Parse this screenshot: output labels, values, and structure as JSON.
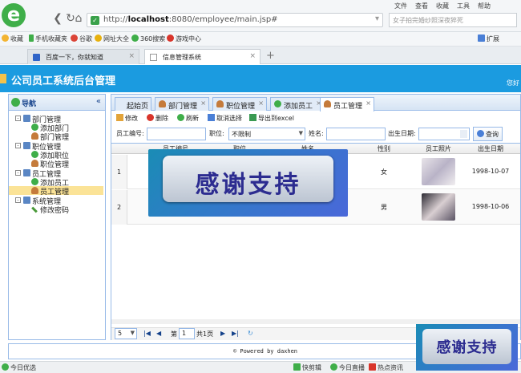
{
  "browser": {
    "address_prefix": "http://",
    "address_host": "localhost",
    "address_rest": ":8080/employee/main.jsp#",
    "search_placeholder": "女子拍完婚纱照深夜猝死",
    "menu": [
      "文件",
      "查看",
      "收藏",
      "工具",
      "帮助"
    ],
    "bookmarks": [
      "收藏",
      "手机收藏夹",
      "谷歌",
      "网址大全",
      "360搜索",
      "游戏中心"
    ],
    "extension_label": "扩展",
    "tabs": [
      {
        "label": "百度一下，你就知道"
      },
      {
        "label": "信息管理系统"
      }
    ]
  },
  "app": {
    "title": "公司员工系统后台管理",
    "welcome": "您好"
  },
  "nav": {
    "title": "导航",
    "items": [
      {
        "label": "部门管理",
        "level": 0
      },
      {
        "label": "添加部门",
        "level": 1
      },
      {
        "label": "部门管理",
        "level": 1
      },
      {
        "label": "职位管理",
        "level": 0
      },
      {
        "label": "添加职位",
        "level": 1
      },
      {
        "label": "职位管理",
        "level": 1
      },
      {
        "label": "员工管理",
        "level": 0
      },
      {
        "label": "添加员工",
        "level": 1
      },
      {
        "label": "员工管理",
        "level": 1,
        "selected": true
      },
      {
        "label": "系统管理",
        "level": 0
      },
      {
        "label": "修改密码",
        "level": 1
      }
    ]
  },
  "tabs": [
    {
      "label": "起始页"
    },
    {
      "label": "部门管理"
    },
    {
      "label": "职位管理"
    },
    {
      "label": "添加员工"
    },
    {
      "label": "员工管理",
      "active": true
    }
  ],
  "toolbar": {
    "edit": "修改",
    "delete": "删除",
    "refresh": "刷新",
    "deselect": "取消选择",
    "export": "导出到excel"
  },
  "filter": {
    "emp_no_label": "员工编号:",
    "position_label": "职位:",
    "position_value": "不限制",
    "name_label": "姓名:",
    "birth_label": "出生日期:",
    "query_label": "查询"
  },
  "grid": {
    "columns": [
      "员工编号",
      "职位",
      "姓名",
      "性别",
      "员工照片",
      "出生日期"
    ],
    "rows": [
      {
        "num": "1",
        "gender": "女",
        "birth": "1998-10-07"
      },
      {
        "num": "2",
        "gender": "男",
        "birth": "1998-10-06"
      }
    ]
  },
  "pager": {
    "page_size": "5",
    "page_prefix": "第",
    "page_value": "1",
    "page_suffix": "共1页"
  },
  "footer": {
    "text": "© Powered by daxhen"
  },
  "statusbar": {
    "left": "今日优选",
    "items": [
      "快剪辑",
      "今日直播",
      "热点资讯"
    ]
  },
  "overlay": {
    "text": "感谢支持"
  }
}
